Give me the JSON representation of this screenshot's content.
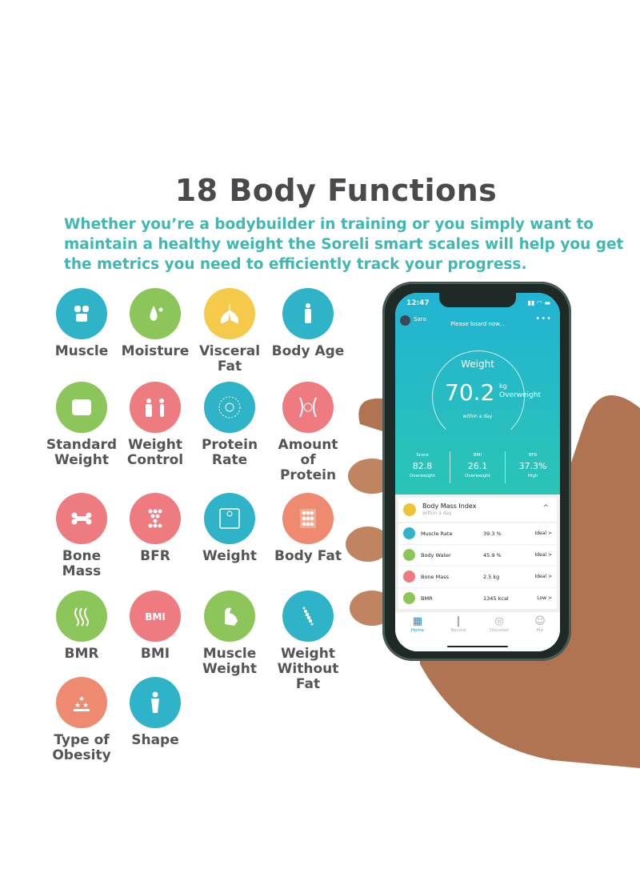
{
  "header": {
    "title": "18 Body Functions",
    "subtitle": "Whether you’re a bodybuilder in training or you simply want to maintain a healthy weight the Soreli smart scales will help you get the metrics you need to efficiently track your progress."
  },
  "colors": {
    "teal": "#2eb3c9",
    "green": "#8cc65a",
    "yellow": "#f5c94a",
    "pink": "#ee7b80",
    "orange": "#ee8a6f",
    "accent_text": "#3fb8b3"
  },
  "functions": [
    {
      "label": "Muscle",
      "icon": "muscle-icon",
      "color": "#2eb3c9"
    },
    {
      "label": "Moisture",
      "icon": "water-drop-icon",
      "color": "#8cc65a"
    },
    {
      "label": "Visceral Fat",
      "icon": "lungs-icon",
      "color": "#f5c94a"
    },
    {
      "label": "Body Age",
      "icon": "person-icon",
      "color": "#2eb3c9"
    },
    {
      "label": "Standard Weight",
      "icon": "scale-feet-icon",
      "color": "#8cc65a"
    },
    {
      "label": "Weight Control",
      "icon": "weight-control-icon",
      "color": "#ee7b80"
    },
    {
      "label": "Protein Rate",
      "icon": "protein-icon",
      "color": "#2eb3c9"
    },
    {
      "label": "Amount of Protein",
      "icon": "protein-amount-icon",
      "color": "#ee7b80"
    },
    {
      "label": "Bone Mass",
      "icon": "bone-icon",
      "color": "#ee7b80"
    },
    {
      "label": "BFR",
      "icon": "fat-cells-icon",
      "color": "#ee7b80"
    },
    {
      "label": "Weight",
      "icon": "scale-icon",
      "color": "#2eb3c9"
    },
    {
      "label": "Body Fat",
      "icon": "body-fat-icon",
      "color": "#ee8a6f"
    },
    {
      "label": "BMR",
      "icon": "heat-waves-icon",
      "color": "#8cc65a"
    },
    {
      "label": "BMI",
      "icon": "bmi-icon",
      "color": "#ee7b80",
      "text": "BMI"
    },
    {
      "label": "Muscle Weight",
      "icon": "flexed-arm-icon",
      "color": "#8cc65a"
    },
    {
      "label": "Weight Without Fat",
      "icon": "spine-icon",
      "color": "#2eb3c9"
    },
    {
      "label": "Type of Obesity",
      "icon": "stars-icon",
      "color": "#ee8a6f"
    },
    {
      "label": "Shape",
      "icon": "body-shape-icon",
      "color": "#2eb3c9"
    }
  ],
  "phone": {
    "time": "12:47",
    "user": "Sara",
    "prompt": "Please board now...",
    "menu": "•••",
    "weight": {
      "label": "Weight",
      "value": "70.2",
      "unit": "kg",
      "status": "Overweight",
      "sub": "within a day"
    },
    "stats": [
      {
        "key": "Score",
        "value": "82.8",
        "status": "Overweight"
      },
      {
        "key": "BMI",
        "value": "26.1",
        "status": "Overweight"
      },
      {
        "key": "BFR",
        "value": "37.3%",
        "status": "High"
      }
    ],
    "bmi_card": {
      "title": "Body Mass Index",
      "sub": "within a day",
      "caret": "^"
    },
    "rows": [
      {
        "name": "Muscle Rate",
        "value": "39.3 %",
        "status": "Ideal >",
        "color": "#2eb3c9"
      },
      {
        "name": "Body Water",
        "value": "45.9 %",
        "status": "Ideal >",
        "color": "#8cc65a"
      },
      {
        "name": "Bone Mass",
        "value": "2.5 kg",
        "status": "Ideal >",
        "color": "#ee7b80"
      },
      {
        "name": "BMR",
        "value": "1345 kcal",
        "status": "Low >",
        "color": "#8cc65a"
      }
    ],
    "tabs": [
      {
        "label": "Home",
        "icon": "▦"
      },
      {
        "label": "Record",
        "icon": "❙"
      },
      {
        "label": "Discover",
        "icon": "◎"
      },
      {
        "label": "Me",
        "icon": "☺"
      }
    ]
  }
}
